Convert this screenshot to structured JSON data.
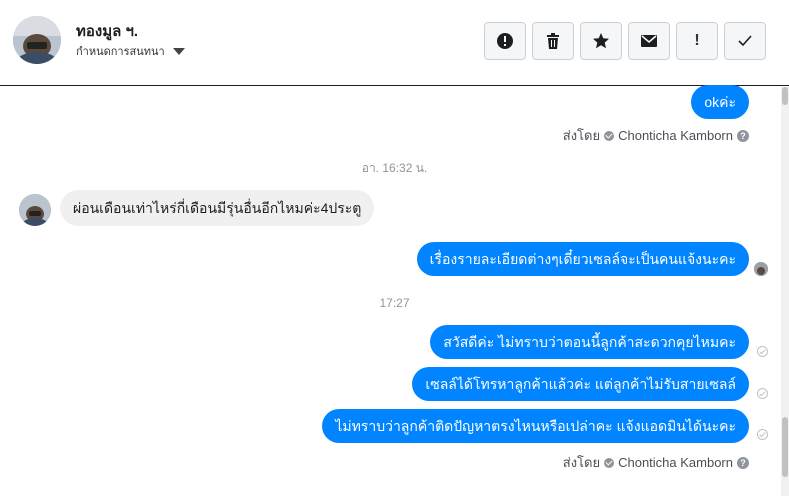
{
  "header": {
    "contact_name": "ทองมูล ฯ.",
    "settings_label": "กำหนดการสนทนา",
    "toolbar": [
      {
        "icon": "alert-circle-icon",
        "name": "report-button"
      },
      {
        "icon": "trash-icon",
        "name": "delete-button"
      },
      {
        "icon": "star-icon",
        "name": "star-button"
      },
      {
        "icon": "envelope-icon",
        "name": "mark-unread-button"
      },
      {
        "icon": "exclamation-icon",
        "name": "flag-button",
        "glyph": "!"
      },
      {
        "icon": "checkmark-icon",
        "name": "mark-done-button"
      }
    ]
  },
  "thread": {
    "msg_ok": "okค่ะ",
    "sent_by_1": "ส่งโดย",
    "sender_1": "Chonticha Kamborn",
    "timestamp_1": "อา. 16:32 น.",
    "msg_in_1": "ผ่อนเดือนเท่าไหร่กี่เดือนมีรุ่นอื่นอีกไหมค่ะ4ประตู",
    "msg_out_1": "เรื่องรายละเอียดต่างๆเดี๋ยวเซลล์จะเป็นคนแจ้งนะคะ",
    "timestamp_2": "17:27",
    "msg_out_2": "สวัสดีค่ะ ไม่ทราบว่าตอนนี้ลูกค้าสะดวกคุยไหมคะ",
    "msg_out_3": "เซลล์ได้โทรหาลูกค้าแล้วค่ะ แต่ลูกค้าไม่รับสายเซลล์",
    "msg_out_4": "ไม่ทราบว่าลูกค้าติดปัญหาตรงไหนหรือเปล่าคะ แจ้งแอดมินได้นะคะ",
    "sent_by_2": "ส่งโดย",
    "sender_2": "Chonticha Kamborn",
    "help_glyph": "?"
  },
  "colors": {
    "outgoing_bubble": "#0084ff",
    "incoming_bubble": "#f1f0f0",
    "muted_text": "#90949c"
  }
}
